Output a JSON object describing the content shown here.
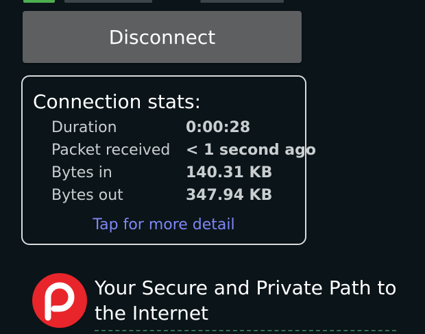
{
  "disconnect_label": "Disconnect",
  "stats": {
    "title": "Connection stats:",
    "rows": [
      {
        "label": "Duration",
        "value": "0:00:28"
      },
      {
        "label": "Packet received",
        "value": "< 1 second ago"
      },
      {
        "label": "Bytes in",
        "value": "140.31 KB"
      },
      {
        "label": "Bytes out",
        "value": "347.94 KB"
      }
    ],
    "detail_link": "Tap for more detail"
  },
  "brand": {
    "logo_icon": "path-logo-icon",
    "logo_color": "#e8252a",
    "tagline": "Your Secure and Private Path to the Internet"
  },
  "colors": {
    "background": "#0b1418",
    "button": "#5d5f61",
    "link": "#7d87f5",
    "status_green": "#4caf50"
  }
}
